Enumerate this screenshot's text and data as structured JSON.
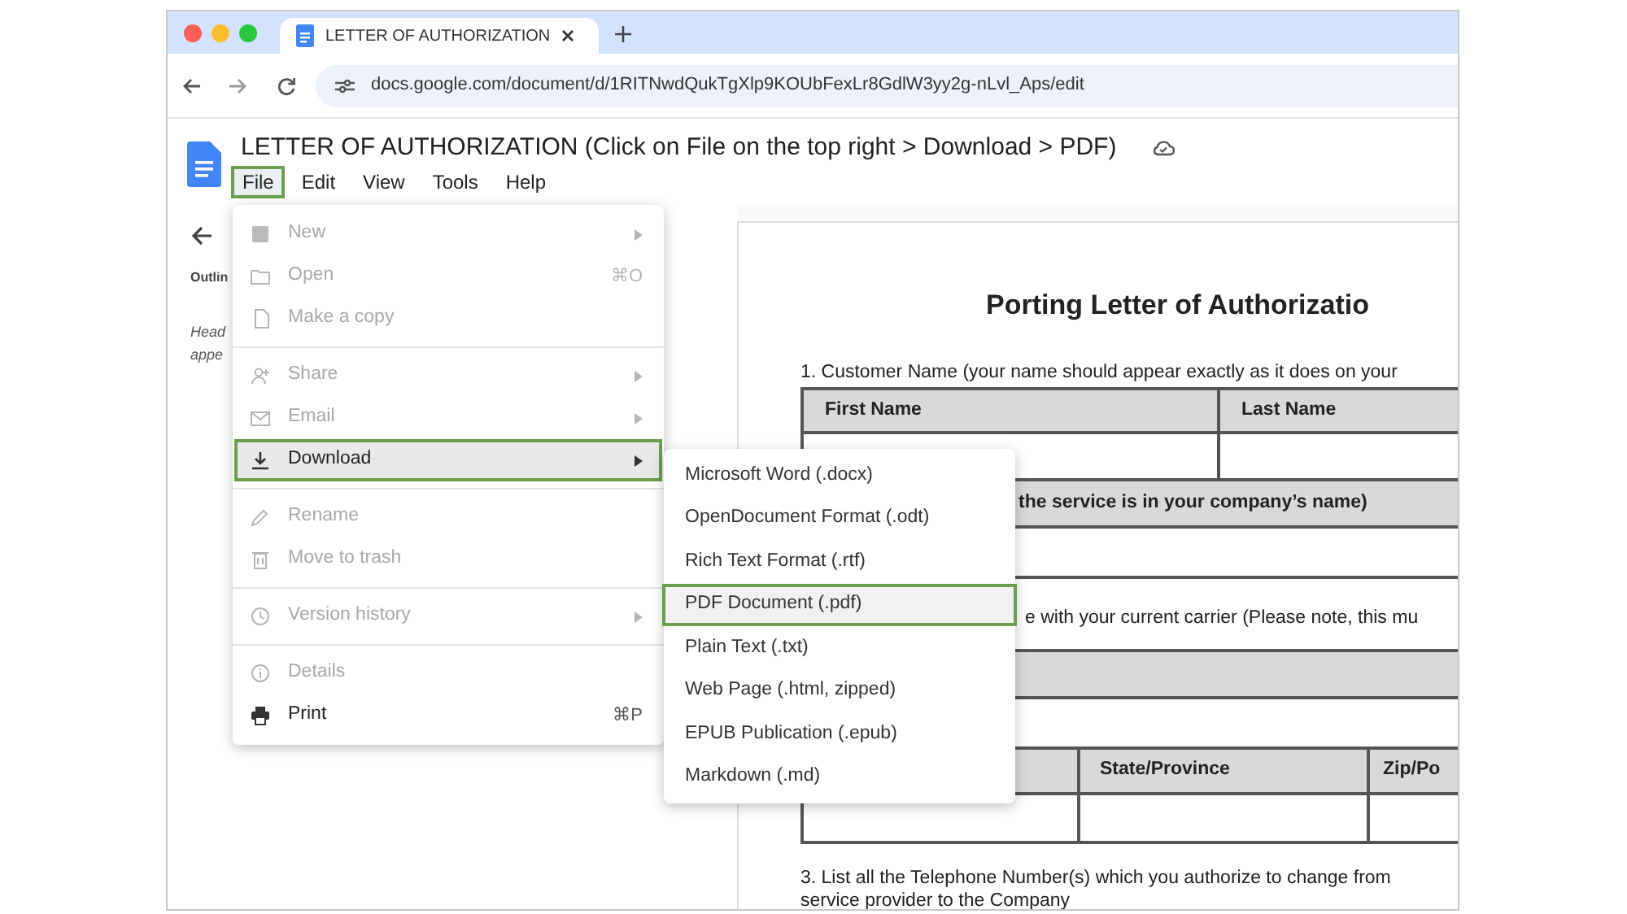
{
  "browser": {
    "tab_title": "LETTER OF AUTHORIZATION",
    "url": "docs.google.com/document/d/1RITNwdQukTgXlp9KOUbFexLr8GdlW3yy2g-nLvl_Aps/edit"
  },
  "document": {
    "title": "LETTER OF AUTHORIZATION (Click on File on the top right > Download > PDF)",
    "menus": [
      {
        "label": "File",
        "selected": true
      },
      {
        "label": "Edit",
        "selected": false
      },
      {
        "label": "View",
        "selected": false
      },
      {
        "label": "Tools",
        "selected": false
      },
      {
        "label": "Help",
        "selected": false
      }
    ]
  },
  "outline": {
    "label": "Outlin",
    "hint_lines": [
      "Head",
      "appe"
    ]
  },
  "file_menu": {
    "sections": [
      [
        {
          "label": "New",
          "submenu": true,
          "disabled": true,
          "selected": false
        },
        {
          "label": "Open",
          "shortcut": "⌘O",
          "disabled": true,
          "selected": false
        },
        {
          "label": "Make a copy",
          "disabled": true,
          "selected": false
        }
      ],
      [
        {
          "label": "Share",
          "submenu": true,
          "disabled": true,
          "selected": false
        },
        {
          "label": "Email",
          "submenu": true,
          "disabled": true,
          "selected": false
        },
        {
          "label": "Download",
          "submenu": true,
          "disabled": false,
          "selected": true
        }
      ],
      [
        {
          "label": "Rename",
          "disabled": true,
          "selected": false
        },
        {
          "label": "Move to trash",
          "disabled": true,
          "selected": false
        }
      ],
      [
        {
          "label": "Version history",
          "submenu": true,
          "disabled": true,
          "selected": false
        }
      ],
      [
        {
          "label": "Details",
          "disabled": true,
          "selected": false
        },
        {
          "label": "Print",
          "shortcut": "⌘P",
          "disabled": false,
          "selected": false
        }
      ]
    ]
  },
  "download_menu": [
    {
      "label": "Microsoft Word (.docx)",
      "selected": false
    },
    {
      "label": "OpenDocument Format (.odt)",
      "selected": false
    },
    {
      "label": "Rich Text Format (.rtf)",
      "selected": false
    },
    {
      "label": "PDF Document (.pdf)",
      "selected": true
    },
    {
      "label": "Plain Text (.txt)",
      "selected": false
    },
    {
      "label": "Web Page (.html, zipped)",
      "selected": false
    },
    {
      "label": "EPUB Publication (.epub)",
      "selected": false
    },
    {
      "label": "Markdown (.md)",
      "selected": false
    }
  ],
  "letter": {
    "heading": "Porting Letter of Authorizatio",
    "question_1": "1. Customer Name (your name should appear exactly as it does on your",
    "name_table": {
      "columns": [
        "First Name",
        "Last Name"
      ]
    },
    "company_row": "the service is in your company’s name)",
    "question_2": "e with your current carrier (Please note, this mu",
    "address_table": {
      "columns": [
        "State/Province",
        "Zip/Po"
      ]
    },
    "question_3": [
      "3. List all the Telephone Number(s) which you authorize to change from",
      "service provider to the Company"
    ]
  }
}
